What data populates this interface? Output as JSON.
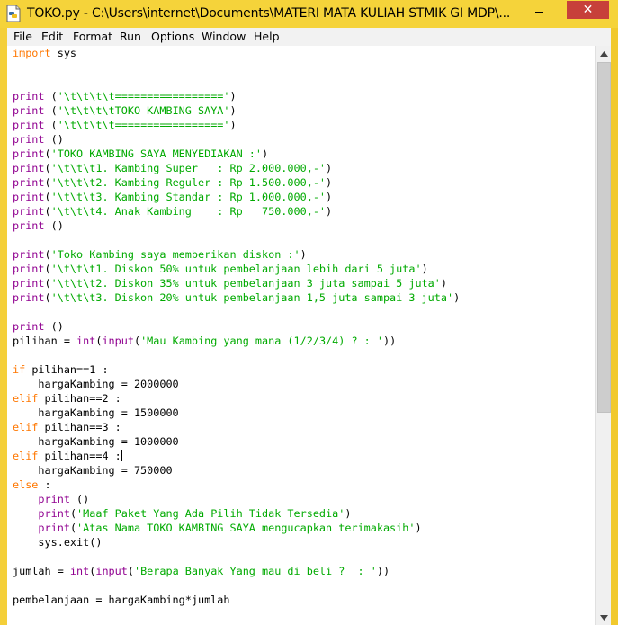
{
  "window": {
    "title": "TOKO.py - C:\\Users\\internet\\Documents\\MATERI MATA KULIAH STMIK GI MDP\\...",
    "close_label": "✕"
  },
  "menu": [
    "File",
    "Edit",
    "Format",
    "Run",
    "Options",
    "Window",
    "Help"
  ],
  "code_lines": [
    [
      {
        "t": "import",
        "c": "kw"
      },
      {
        "t": " sys"
      }
    ],
    [],
    [],
    [
      {
        "t": "print",
        "c": "bi"
      },
      {
        "t": " ("
      },
      {
        "t": "'\\t\\t\\t\\t================='",
        "c": "str"
      },
      {
        "t": ")"
      }
    ],
    [
      {
        "t": "print",
        "c": "bi"
      },
      {
        "t": " ("
      },
      {
        "t": "'\\t\\t\\t\\tTOKO KAMBING SAYA'",
        "c": "str"
      },
      {
        "t": ")"
      }
    ],
    [
      {
        "t": "print",
        "c": "bi"
      },
      {
        "t": " ("
      },
      {
        "t": "'\\t\\t\\t\\t================='",
        "c": "str"
      },
      {
        "t": ")"
      }
    ],
    [
      {
        "t": "print",
        "c": "bi"
      },
      {
        "t": " ()"
      }
    ],
    [
      {
        "t": "print",
        "c": "bi"
      },
      {
        "t": "("
      },
      {
        "t": "'TOKO KAMBING SAYA MENYEDIAKAN :'",
        "c": "str"
      },
      {
        "t": ")"
      }
    ],
    [
      {
        "t": "print",
        "c": "bi"
      },
      {
        "t": "("
      },
      {
        "t": "'\\t\\t\\t1. Kambing Super   : Rp 2.000.000,-'",
        "c": "str"
      },
      {
        "t": ")"
      }
    ],
    [
      {
        "t": "print",
        "c": "bi"
      },
      {
        "t": "("
      },
      {
        "t": "'\\t\\t\\t2. Kambing Reguler : Rp 1.500.000,-'",
        "c": "str"
      },
      {
        "t": ")"
      }
    ],
    [
      {
        "t": "print",
        "c": "bi"
      },
      {
        "t": "("
      },
      {
        "t": "'\\t\\t\\t3. Kambing Standar : Rp 1.000.000,-'",
        "c": "str"
      },
      {
        "t": ")"
      }
    ],
    [
      {
        "t": "print",
        "c": "bi"
      },
      {
        "t": "("
      },
      {
        "t": "'\\t\\t\\t4. Anak Kambing    : Rp   750.000,-'",
        "c": "str"
      },
      {
        "t": ")"
      }
    ],
    [
      {
        "t": "print",
        "c": "bi"
      },
      {
        "t": " ()"
      }
    ],
    [],
    [
      {
        "t": "print",
        "c": "bi"
      },
      {
        "t": "("
      },
      {
        "t": "'Toko Kambing saya memberikan diskon :'",
        "c": "str"
      },
      {
        "t": ")"
      }
    ],
    [
      {
        "t": "print",
        "c": "bi"
      },
      {
        "t": "("
      },
      {
        "t": "'\\t\\t\\t1. Diskon 50% untuk pembelanjaan lebih dari 5 juta'",
        "c": "str"
      },
      {
        "t": ")"
      }
    ],
    [
      {
        "t": "print",
        "c": "bi"
      },
      {
        "t": "("
      },
      {
        "t": "'\\t\\t\\t2. Diskon 35% untuk pembelanjaan 3 juta sampai 5 juta'",
        "c": "str"
      },
      {
        "t": ")"
      }
    ],
    [
      {
        "t": "print",
        "c": "bi"
      },
      {
        "t": "("
      },
      {
        "t": "'\\t\\t\\t3. Diskon 20% untuk pembelanjaan 1,5 juta sampai 3 juta'",
        "c": "str"
      },
      {
        "t": ")"
      }
    ],
    [],
    [
      {
        "t": "print",
        "c": "bi"
      },
      {
        "t": " ()"
      }
    ],
    [
      {
        "t": "pilihan = "
      },
      {
        "t": "int",
        "c": "bi"
      },
      {
        "t": "("
      },
      {
        "t": "input",
        "c": "bi"
      },
      {
        "t": "("
      },
      {
        "t": "'Mau Kambing yang mana (1/2/3/4) ? : '",
        "c": "str"
      },
      {
        "t": "))"
      }
    ],
    [],
    [
      {
        "t": "if",
        "c": "kw"
      },
      {
        "t": " pilihan==1 :"
      }
    ],
    [
      {
        "t": "    hargaKambing = 2000000"
      }
    ],
    [
      {
        "t": "elif",
        "c": "kw"
      },
      {
        "t": " pilihan==2 :"
      }
    ],
    [
      {
        "t": "    hargaKambing = 1500000"
      }
    ],
    [
      {
        "t": "elif",
        "c": "kw"
      },
      {
        "t": " pilihan==3 :"
      }
    ],
    [
      {
        "t": "    hargaKambing = 1000000"
      }
    ],
    [
      {
        "t": "elif",
        "c": "kw"
      },
      {
        "t": " pilihan==4 :"
      },
      {
        "t": "",
        "c": "caret"
      }
    ],
    [
      {
        "t": "    hargaKambing = 750000"
      }
    ],
    [
      {
        "t": "else",
        "c": "kw"
      },
      {
        "t": " :"
      }
    ],
    [
      {
        "t": "    "
      },
      {
        "t": "print",
        "c": "bi"
      },
      {
        "t": " ()"
      }
    ],
    [
      {
        "t": "    "
      },
      {
        "t": "print",
        "c": "bi"
      },
      {
        "t": "("
      },
      {
        "t": "'Maaf Paket Yang Ada Pilih Tidak Tersedia'",
        "c": "str"
      },
      {
        "t": ")"
      }
    ],
    [
      {
        "t": "    "
      },
      {
        "t": "print",
        "c": "bi"
      },
      {
        "t": "("
      },
      {
        "t": "'Atas Nama TOKO KAMBING SAYA mengucapkan terimakasih'",
        "c": "str"
      },
      {
        "t": ")"
      }
    ],
    [
      {
        "t": "    sys.exit()"
      }
    ],
    [],
    [
      {
        "t": "jumlah = "
      },
      {
        "t": "int",
        "c": "bi"
      },
      {
        "t": "("
      },
      {
        "t": "input",
        "c": "bi"
      },
      {
        "t": "("
      },
      {
        "t": "'Berapa Banyak Yang mau di beli ?  : '",
        "c": "str"
      },
      {
        "t": "))"
      }
    ],
    [],
    [
      {
        "t": "pembelanjaan = hargaKambing*jumlah"
      }
    ]
  ],
  "scrollbar": {
    "position": 0.0
  }
}
